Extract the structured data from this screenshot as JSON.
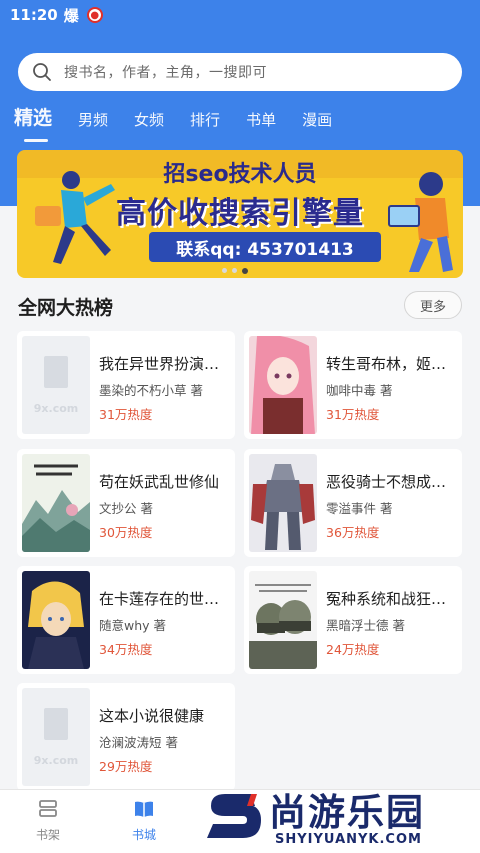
{
  "status_bar": {
    "time": "11:20",
    "label": "爆"
  },
  "search": {
    "placeholder": "搜书名，作者，主角，一搜即可"
  },
  "tabs": [
    {
      "label": "精选",
      "active": true
    },
    {
      "label": "男频"
    },
    {
      "label": "女频"
    },
    {
      "label": "排行"
    },
    {
      "label": "书单"
    },
    {
      "label": "漫画"
    }
  ],
  "banner": {
    "title_top": "招seo技术人员",
    "title_main": "高价收搜索引擎量",
    "contact": "联系qq: 453701413",
    "dots": 3,
    "active_dot": 2
  },
  "section": {
    "title": "全网大热榜",
    "more_label": "更多"
  },
  "books": [
    {
      "title": "我在异世界扮演动...",
      "author": "墨染的不朽小草 著",
      "heat": "31万热度",
      "cover": "placeholder"
    },
    {
      "title": "转生哥布林，姬骑...",
      "author": "咖啡中毒 著",
      "heat": "31万热度",
      "cover": "anime-girl"
    },
    {
      "title": "苟在妖武乱世修仙",
      "author": "文抄公 著",
      "heat": "30万热度",
      "cover": "ink-landscape"
    },
    {
      "title": "恶役骑士不想成为...",
      "author": "零溢事件 著",
      "heat": "36万热度",
      "cover": "mecha"
    },
    {
      "title": "在卡莲存在的世界...",
      "author": "随意why 著",
      "heat": "34万热度",
      "cover": "blonde-boy"
    },
    {
      "title": "冤种系统和战狂的...",
      "author": "黑暗浮士德 著",
      "heat": "24万热度",
      "cover": "helmets"
    },
    {
      "title": "这本小说很健康",
      "author": "沧澜波涛短 著",
      "heat": "29万热度",
      "cover": "placeholder"
    }
  ],
  "placeholder_cover_text": "9x.com",
  "bottom_nav": [
    {
      "label": "书架",
      "icon": "bookshelf-icon"
    },
    {
      "label": "书城",
      "icon": "book-open-icon",
      "active": true
    }
  ],
  "watermark": {
    "cn": "尚游乐园",
    "en": "SHYIYUANYK.COM"
  },
  "colors": {
    "primary": "#3d82ea",
    "heat": "#e0563a",
    "banner_bg": "#f7c928"
  }
}
